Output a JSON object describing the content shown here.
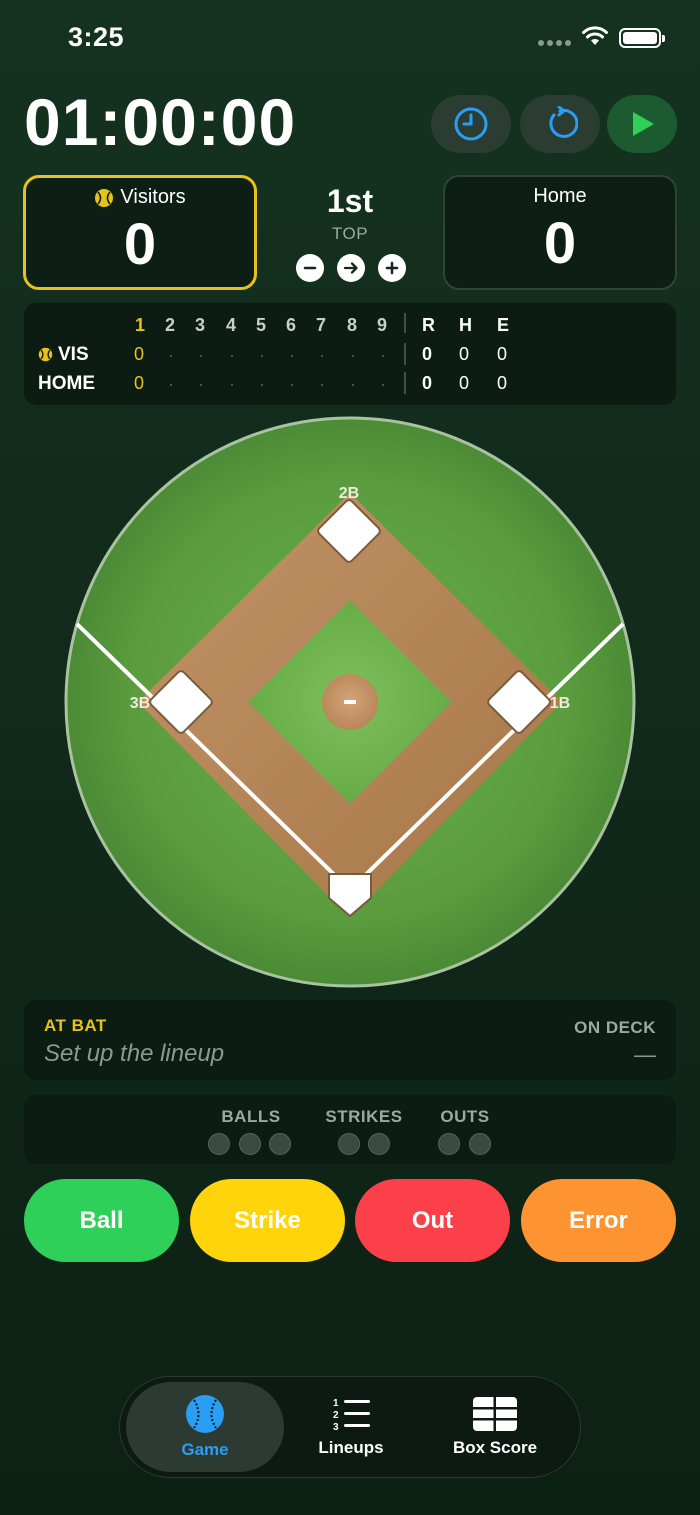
{
  "status_bar": {
    "time": "3:25"
  },
  "clock": {
    "display": "01:00:00"
  },
  "icons": {
    "clock_button": "clock-icon",
    "reset_button": "reset-icon",
    "play_button": "play-icon"
  },
  "visitors": {
    "name": "Visitors",
    "score": "0",
    "batting_indicator": "baseball-icon"
  },
  "home": {
    "name": "Home",
    "score": "0"
  },
  "inning": {
    "number": "1st",
    "half": "TOP",
    "minus": "−",
    "next": "→",
    "plus": "+"
  },
  "linescore": {
    "innings": [
      "1",
      "2",
      "3",
      "4",
      "5",
      "6",
      "7",
      "8",
      "9"
    ],
    "totals_headers": [
      "R",
      "H",
      "E"
    ],
    "teams": [
      {
        "abbr": "VIS",
        "first": "0",
        "runs": "0",
        "hits": "0",
        "errors": "0"
      },
      {
        "abbr": "HOME",
        "first": "0",
        "runs": "0",
        "hits": "0",
        "errors": "0"
      }
    ]
  },
  "field": {
    "bases": [
      "2B",
      "3B",
      "1B"
    ],
    "mound_label": "-"
  },
  "at_bat": {
    "label": "AT BAT",
    "value": "Set up the lineup"
  },
  "on_deck": {
    "label": "ON DECK",
    "value": "—"
  },
  "count": {
    "balls_label": "BALLS",
    "strikes_label": "STRIKES",
    "outs_label": "OUTS",
    "balls": 0,
    "strikes": 0,
    "outs": 0
  },
  "actions": {
    "ball": "Ball",
    "strike": "Strike",
    "out": "Out",
    "error": "Error"
  },
  "colors": {
    "ball": "#2fd05a",
    "strike": "#ffd40a",
    "out": "#fb4049",
    "error": "#fd9431",
    "accent": "#2a9df4",
    "highlight": "#e6c21a"
  },
  "tabs": {
    "game": "Game",
    "lineups": "Lineups",
    "box_score": "Box Score"
  }
}
